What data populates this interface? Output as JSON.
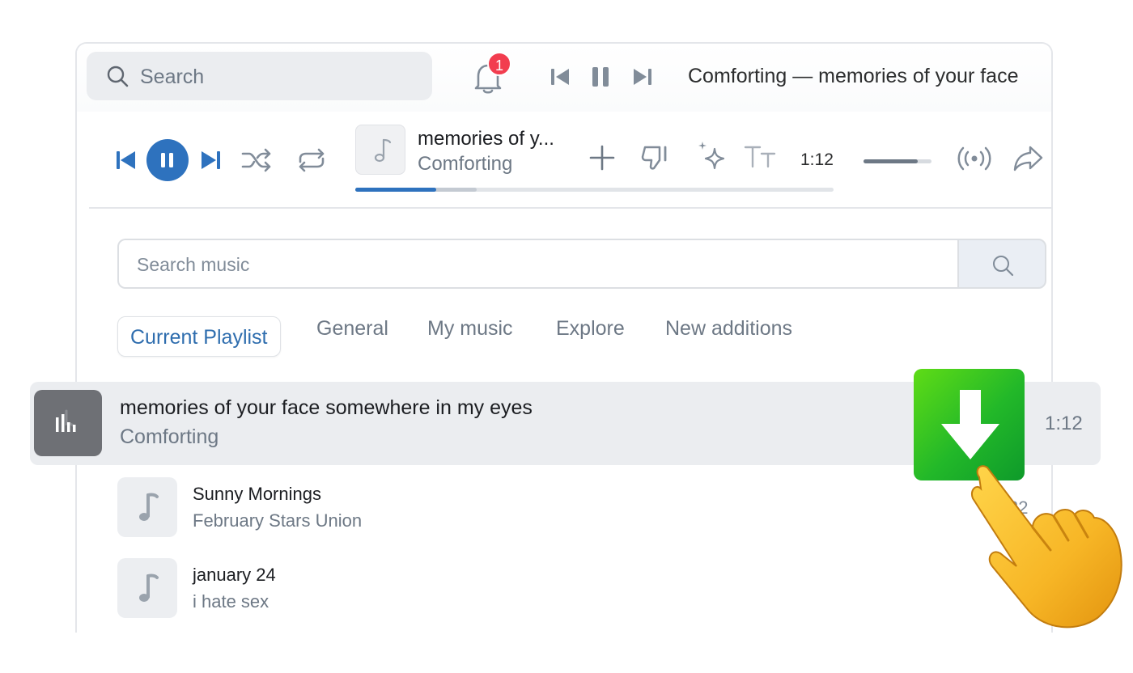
{
  "header": {
    "search_placeholder": "Search",
    "notification_count": "1",
    "now_playing_text": "Comforting — memories of your face"
  },
  "player": {
    "track_title": "memories of y...",
    "track_artist": "Comforting",
    "elapsed": "1:12",
    "progress": 0.17,
    "volume": 0.8
  },
  "music_search": {
    "placeholder": "Search music"
  },
  "tabs": [
    {
      "label": "Current Playlist",
      "active": true
    },
    {
      "label": "General"
    },
    {
      "label": "My music"
    },
    {
      "label": "Explore"
    },
    {
      "label": "New additions"
    }
  ],
  "tracks": [
    {
      "title": "memories of your face somewhere in my eyes",
      "artist": "Comforting",
      "duration": "1:12",
      "playing": true
    },
    {
      "title": "Sunny Mornings",
      "artist": "February Stars Union",
      "duration": "32"
    },
    {
      "title": "january 24",
      "artist": "i hate sex",
      "duration": ""
    }
  ],
  "colors": {
    "accent": "#2e72be",
    "badge": "#f23d4f",
    "download_green": "#22b829"
  },
  "icons": [
    "search-icon",
    "bell-icon",
    "previous-icon",
    "pause-icon",
    "next-icon",
    "shuffle-icon",
    "repeat-icon",
    "music-note-icon",
    "add-icon",
    "dislike-icon",
    "sparkle-icon",
    "text-size-icon",
    "broadcast-icon",
    "share-icon",
    "download-icon",
    "pointing-hand-icon",
    "equalizer-icon"
  ]
}
